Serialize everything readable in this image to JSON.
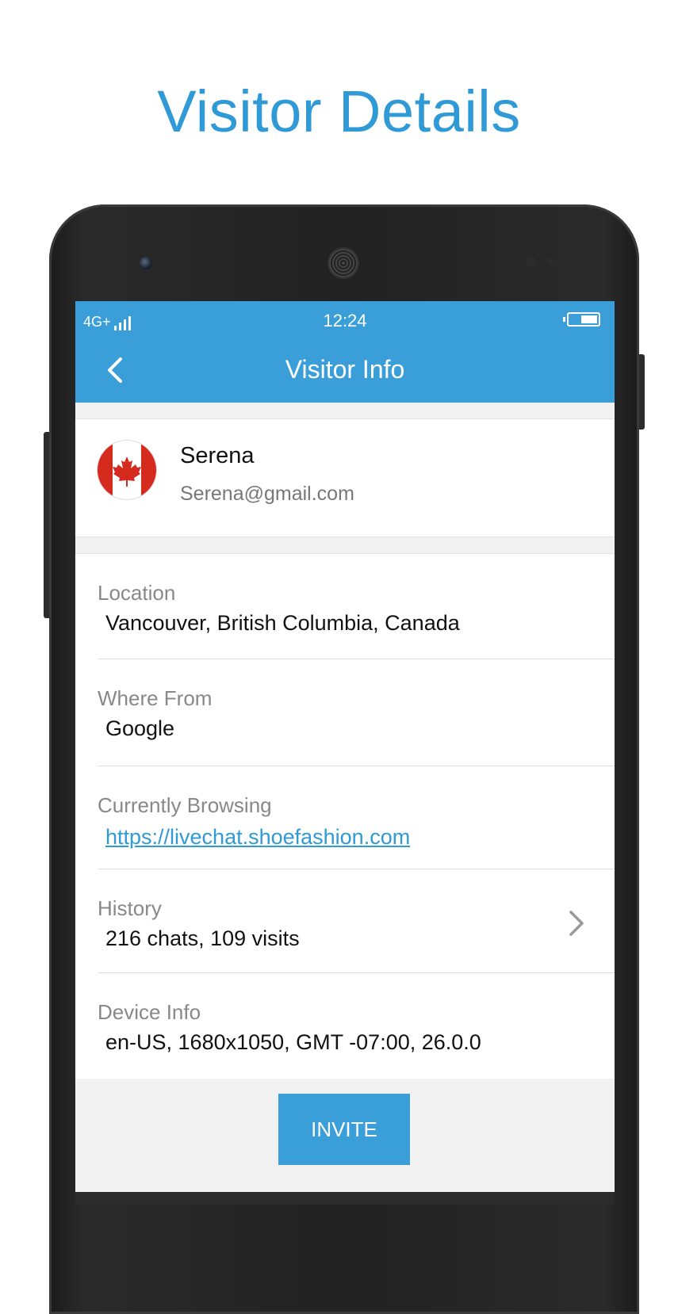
{
  "promo": {
    "title": "Visitor Details"
  },
  "status_bar": {
    "network": "4G+",
    "time": "12:24"
  },
  "nav": {
    "title": "Visitor Info"
  },
  "visitor": {
    "name": "Serena",
    "email": "Serena@gmail.com",
    "flag": "canada-flag-icon"
  },
  "details": [
    {
      "label": "Location",
      "value": "Vancouver, British Columbia, Canada"
    },
    {
      "label": "Where From",
      "value": "Google"
    },
    {
      "label": "Currently Browsing",
      "value": "https://livechat.shoefashion.com"
    },
    {
      "label": "History",
      "value": "216 chats, 109 visits"
    },
    {
      "label": "Device Info",
      "value": "en-US, 1680x1050, GMT -07:00, 26.0.0"
    }
  ],
  "actions": {
    "invite_label": "INVITE"
  },
  "colors": {
    "accent": "#3a9fd8",
    "flag_red": "#d52b1e"
  }
}
